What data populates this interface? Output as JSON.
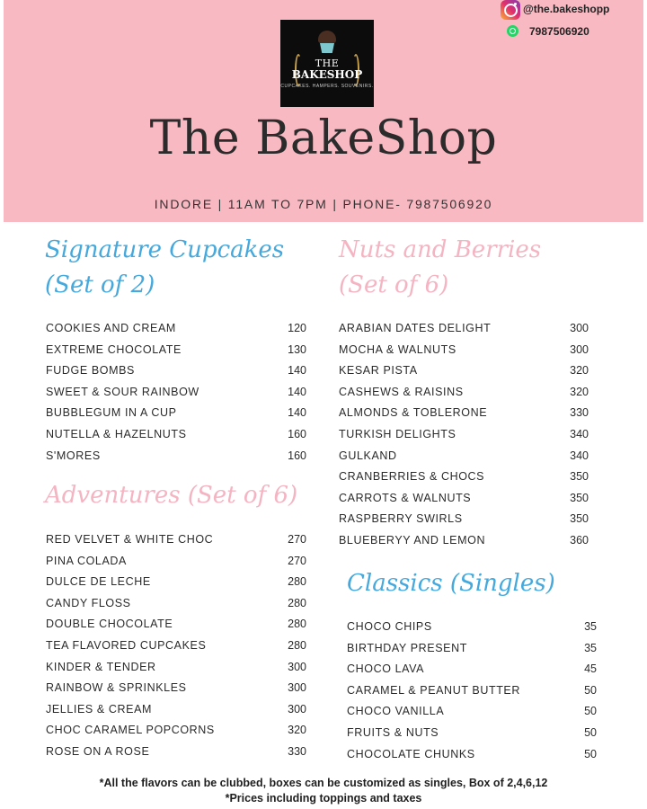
{
  "header": {
    "logo": {
      "line1": "THE",
      "line2": "BAKESHOP",
      "tagline": "CUPCAKES. HAMPERS. SOUVENIRS."
    },
    "title": "The BakeShop",
    "info": "INDORE | 11AM TO 7PM | PHONE- 7987506920"
  },
  "social": {
    "instagram_icon": "instagram-icon",
    "instagram": "@the.bakeshopp",
    "whatsapp_icon": "whatsapp-icon",
    "phone": "7987506920"
  },
  "colors": {
    "header_bg": "#f8b9c2",
    "blue_heading": "#45a9dd",
    "pink_heading": "#f4b4c2"
  },
  "sections": {
    "signature": {
      "title_line1": "Signature Cupcakes",
      "title_line2": "(Set of 2)",
      "items": [
        {
          "name": "COOKIES AND CREAM",
          "price": "120"
        },
        {
          "name": "EXTREME CHOCOLATE",
          "price": "130"
        },
        {
          "name": "FUDGE BOMBS",
          "price": "140"
        },
        {
          "name": "SWEET & SOUR RAINBOW",
          "price": "140"
        },
        {
          "name": "BUBBLEGUM IN A CUP",
          "price": "140"
        },
        {
          "name": "NUTELLA & HAZELNUTS",
          "price": "160"
        },
        {
          "name": "S'MORES",
          "price": "160"
        }
      ]
    },
    "adventures": {
      "title": "Adventures (Set of 6)",
      "items": [
        {
          "name": "RED VELVET & WHITE CHOC",
          "price": "270"
        },
        {
          "name": "PINA COLADA",
          "price": "270"
        },
        {
          "name": "DULCE DE LECHE",
          "price": "280"
        },
        {
          "name": "CANDY FLOSS",
          "price": "280"
        },
        {
          "name": "DOUBLE CHOCOLATE",
          "price": "280"
        },
        {
          "name": "TEA FLAVORED CUPCAKES",
          "price": "280"
        },
        {
          "name": "KINDER & TENDER",
          "price": "300"
        },
        {
          "name": "RAINBOW & SPRINKLES",
          "price": "300"
        },
        {
          "name": "JELLIES & CREAM",
          "price": "300"
        },
        {
          "name": "CHOC CARAMEL POPCORNS",
          "price": "320"
        },
        {
          "name": "ROSE ON A ROSE",
          "price": "330"
        }
      ]
    },
    "nuts": {
      "title_line1": "Nuts and Berries",
      "title_line2": "(Set of 6)",
      "items": [
        {
          "name": "ARABIAN DATES DELIGHT",
          "price": "300"
        },
        {
          "name": "MOCHA & WALNUTS",
          "price": "300"
        },
        {
          "name": "KESAR PISTA",
          "price": "320"
        },
        {
          "name": "CASHEWS & RAISINS",
          "price": "320"
        },
        {
          "name": "ALMONDS & TOBLERONE",
          "price": "330"
        },
        {
          "name": "TURKISH DELIGHTS",
          "price": "340"
        },
        {
          "name": "GULKAND",
          "price": "340"
        },
        {
          "name": "CRANBERRIES & CHOCS",
          "price": "350"
        },
        {
          "name": "CARROTS & WALNUTS",
          "price": "350"
        },
        {
          "name": "RASPBERRY SWIRLS",
          "price": "350"
        },
        {
          "name": "BLUEBERYY AND LEMON",
          "price": "360"
        }
      ]
    },
    "classics": {
      "title": "Classics (Singles)",
      "items": [
        {
          "name": "CHOCO CHIPS",
          "price": "35"
        },
        {
          "name": "BIRTHDAY PRESENT",
          "price": "35"
        },
        {
          "name": "CHOCO LAVA",
          "price": "45"
        },
        {
          "name": "CARAMEL & PEANUT BUTTER",
          "price": "50"
        },
        {
          "name": "CHOCO VANILLA",
          "price": "50"
        },
        {
          "name": "FRUITS & NUTS",
          "price": "50"
        },
        {
          "name": "CHOCOLATE CHUNKS",
          "price": "50"
        }
      ]
    }
  },
  "footer": {
    "note1": "*All the flavors can be clubbed, boxes can be customized as singles, Box of 2,4,6,12",
    "note2": "*Prices including toppings and taxes"
  }
}
